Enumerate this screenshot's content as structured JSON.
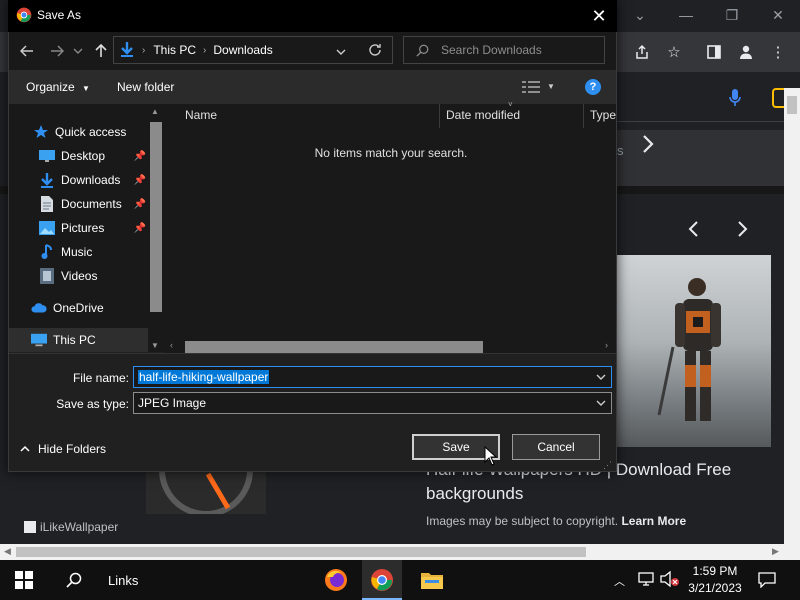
{
  "browser": {
    "caption": "Half-life Wallpapers HD | Download Free backgrounds",
    "copyright_text": "Images may be subject to copyright.",
    "learn_more": "Learn More",
    "site_name": "iLikeWallpaper",
    "strip_partial": "s"
  },
  "dialog": {
    "title": "Save As",
    "breadcrumb": [
      "This PC",
      "Downloads"
    ],
    "search_placeholder": "Search Downloads",
    "organize_label": "Organize",
    "new_folder_label": "New folder",
    "nav_items": [
      {
        "label": "Quick access",
        "icon": "star-icon"
      },
      {
        "label": "Desktop",
        "icon": "desktop-icon",
        "pinned": true
      },
      {
        "label": "Downloads",
        "icon": "download-arrow-icon",
        "pinned": true
      },
      {
        "label": "Documents",
        "icon": "document-icon",
        "pinned": true
      },
      {
        "label": "Pictures",
        "icon": "pictures-icon",
        "pinned": true
      },
      {
        "label": "Music",
        "icon": "music-icon"
      },
      {
        "label": "Videos",
        "icon": "videos-icon"
      },
      {
        "label": "OneDrive",
        "icon": "cloud-icon"
      },
      {
        "label": "This PC",
        "icon": "computer-icon"
      }
    ],
    "columns": [
      "Name",
      "Date modified",
      "Type"
    ],
    "empty_message": "No items match your search.",
    "file_name_label": "File name:",
    "file_name_value": "half-life-hiking-wallpaper",
    "save_type_label": "Save as type:",
    "save_type_value": "JPEG Image",
    "hide_folders_label": "Hide Folders",
    "save_label": "Save",
    "cancel_label": "Cancel"
  },
  "taskbar": {
    "search_label": "Links",
    "time": "1:59 PM",
    "date": "3/21/2023"
  },
  "colors": {
    "selection": "#0078d7",
    "dialog_bg": "#202020",
    "pane_bg": "#191919",
    "taskbar_bg": "#101010"
  }
}
